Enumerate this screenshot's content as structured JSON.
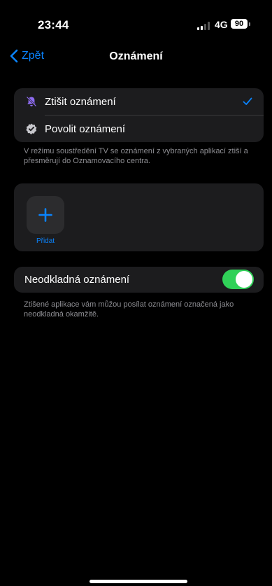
{
  "status_bar": {
    "time": "23:44",
    "network": "4G",
    "battery": "90"
  },
  "nav": {
    "back_label": "Zpět",
    "title": "Oznámení"
  },
  "mode_group": {
    "silence_label": "Ztišit oznámení",
    "silence_selected": true,
    "allow_label": "Povolit oznámení",
    "footer": "V režimu soustředění TV se oznámení z vybraných aplikací ztiší a přesměrují do Oznamovacího centra."
  },
  "apps_group": {
    "add_label": "Přidat"
  },
  "urgent_group": {
    "label": "Neodkladná oznámení",
    "enabled": true,
    "footer": "Ztišené aplikace vám můžou posílat oznámení označená jako neodkladná okamžitě."
  },
  "colors": {
    "accent": "#0a84ff",
    "toggle_on": "#30d158",
    "row_bg": "#1c1c1e",
    "silence_icon": "#8e6cf0"
  }
}
